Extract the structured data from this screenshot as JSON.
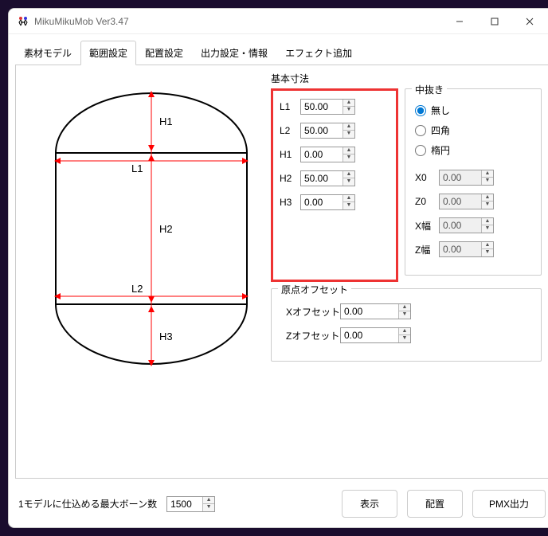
{
  "window": {
    "title": "MikuMikuMob Ver3.47"
  },
  "tabs": {
    "items": [
      {
        "label": "素材モデル"
      },
      {
        "label": "範囲設定"
      },
      {
        "label": "配置設定"
      },
      {
        "label": "出力設定・情報"
      },
      {
        "label": "エフェクト追加"
      }
    ],
    "activeIndex": 1
  },
  "diagram": {
    "labels": {
      "l1": "L1",
      "l2": "L2",
      "h1": "H1",
      "h2": "H2",
      "h3": "H3"
    }
  },
  "basic": {
    "legend": "基本寸法",
    "fields": {
      "l1": {
        "label": "L1",
        "value": "50.00"
      },
      "l2": {
        "label": "L2",
        "value": "50.00"
      },
      "h1": {
        "label": "H1",
        "value": "0.00"
      },
      "h2": {
        "label": "H2",
        "value": "50.00"
      },
      "h3": {
        "label": "H3",
        "value": "0.00"
      }
    }
  },
  "hollow": {
    "legend": "中抜き",
    "radios": {
      "none": "無し",
      "square": "四角",
      "ellipse": "楕円"
    },
    "selected": "none",
    "fields": {
      "x0": {
        "label": "X0",
        "value": "0.00"
      },
      "z0": {
        "label": "Z0",
        "value": "0.00"
      },
      "xw": {
        "label": "X幅",
        "value": "0.00"
      },
      "zw": {
        "label": "Z幅",
        "value": "0.00"
      }
    }
  },
  "origin": {
    "legend": "原点オフセット",
    "fields": {
      "x": {
        "label": "Xオフセット",
        "value": "0.00"
      },
      "z": {
        "label": "Zオフセット",
        "value": "0.00"
      }
    }
  },
  "bottom": {
    "maxBonesLabel": "1モデルに仕込める最大ボーン数",
    "maxBonesValue": "1500",
    "btnShow": "表示",
    "btnPlace": "配置",
    "btnPmx": "PMX出力"
  }
}
